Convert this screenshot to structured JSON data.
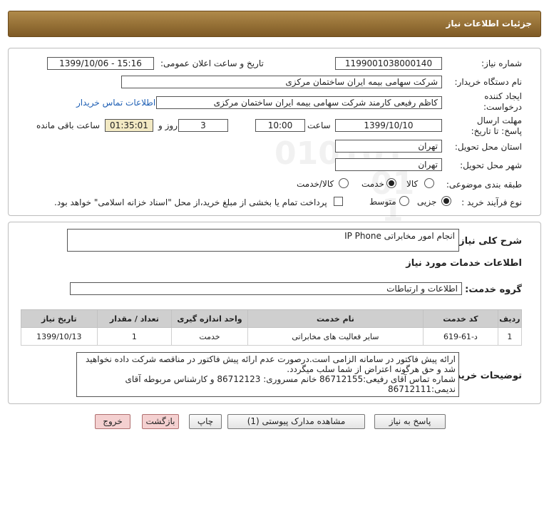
{
  "header": {
    "title": "جزئیات اطلاعات نیاز"
  },
  "watermark": {
    "brand": "ParsNamadData",
    "digits": "010101",
    "digits2": "01",
    "digits3": "1"
  },
  "info": {
    "need_number_label": "شماره نیاز:",
    "need_number": "1199001038000140",
    "announce_label": "تاریخ و ساعت اعلان عمومی:",
    "announce_value": "1399/10/06 - 15:16",
    "buyer_org_label": "نام دستگاه خریدار:",
    "buyer_org": "شرکت سهامی بیمه ایران ساختمان مرکزی",
    "creator_label": "ایجاد کننده درخواست:",
    "creator": "کاظم رفیعی کارمند شرکت سهامی بیمه ایران ساختمان مرکزی",
    "contact_link": "اطلاعات تماس خریدار",
    "deadline_label": "مهلت ارسال پاسخ: تا تاریخ:",
    "deadline_date": "1399/10/10",
    "time_label": "ساعت",
    "deadline_time": "10:00",
    "days_value": "3",
    "days_label": "روز و",
    "remaining_value": "01:35:01",
    "remaining_label": "ساعت باقی مانده",
    "province_label": "استان محل تحویل:",
    "province": "تهران",
    "city_label": "شهر محل تحویل:",
    "city": "تهران",
    "category_label": "طبقه بندی موضوعی:",
    "category_options": [
      "کالا",
      "خدمت",
      "کالا/خدمت"
    ],
    "category_selected": "خدمت",
    "process_label": "نوع فرآیند خرید :",
    "process_options": [
      "جزیی",
      "متوسط"
    ],
    "process_selected": "جزیی",
    "payment_note": "پرداخت تمام یا بخشی از مبلغ خرید،از محل \"اسناد خزانه اسلامی\" خواهد بود."
  },
  "summary": {
    "desc_label": "شرح کلی نیاز:",
    "desc_value": "انجام امور مخابراتی IP Phone",
    "services_heading": "اطلاعات خدمات مورد نیاز",
    "group_label": "گروه خدمت:",
    "group_value": "اطلاعات و ارتباطات",
    "table": {
      "headers": [
        "ردیف",
        "کد خدمت",
        "نام خدمت",
        "واحد اندازه گیری",
        "تعداد / مقدار",
        "تاریخ نیاز"
      ],
      "rows": [
        [
          "1",
          "د-61-619",
          "سایر فعالیت های مخابراتی",
          "خدمت",
          "1",
          "1399/10/13"
        ]
      ]
    },
    "buyer_notes_label": "توضیحات خریدار:",
    "buyer_notes_lines": [
      "ارائه پیش فاکتور در سامانه الزامی است.درصورت عدم ارائه پیش فاکتور در مناقصه شرکت داده نخواهید",
      "شد و حق هرگونه اعتراض از شما سلب میگردد.",
      "شماره تماس آقای رفیعی:86712155  خانم مسروری: 86712123 و کارشناس مربوطه آقای",
      "ندیمی:86712111"
    ]
  },
  "buttons": {
    "reply": "پاسخ به نیاز",
    "attachments": "مشاهده مدارک پیوستی (1)",
    "print": "چاپ",
    "back": "بازگشت",
    "exit": "خروج"
  }
}
